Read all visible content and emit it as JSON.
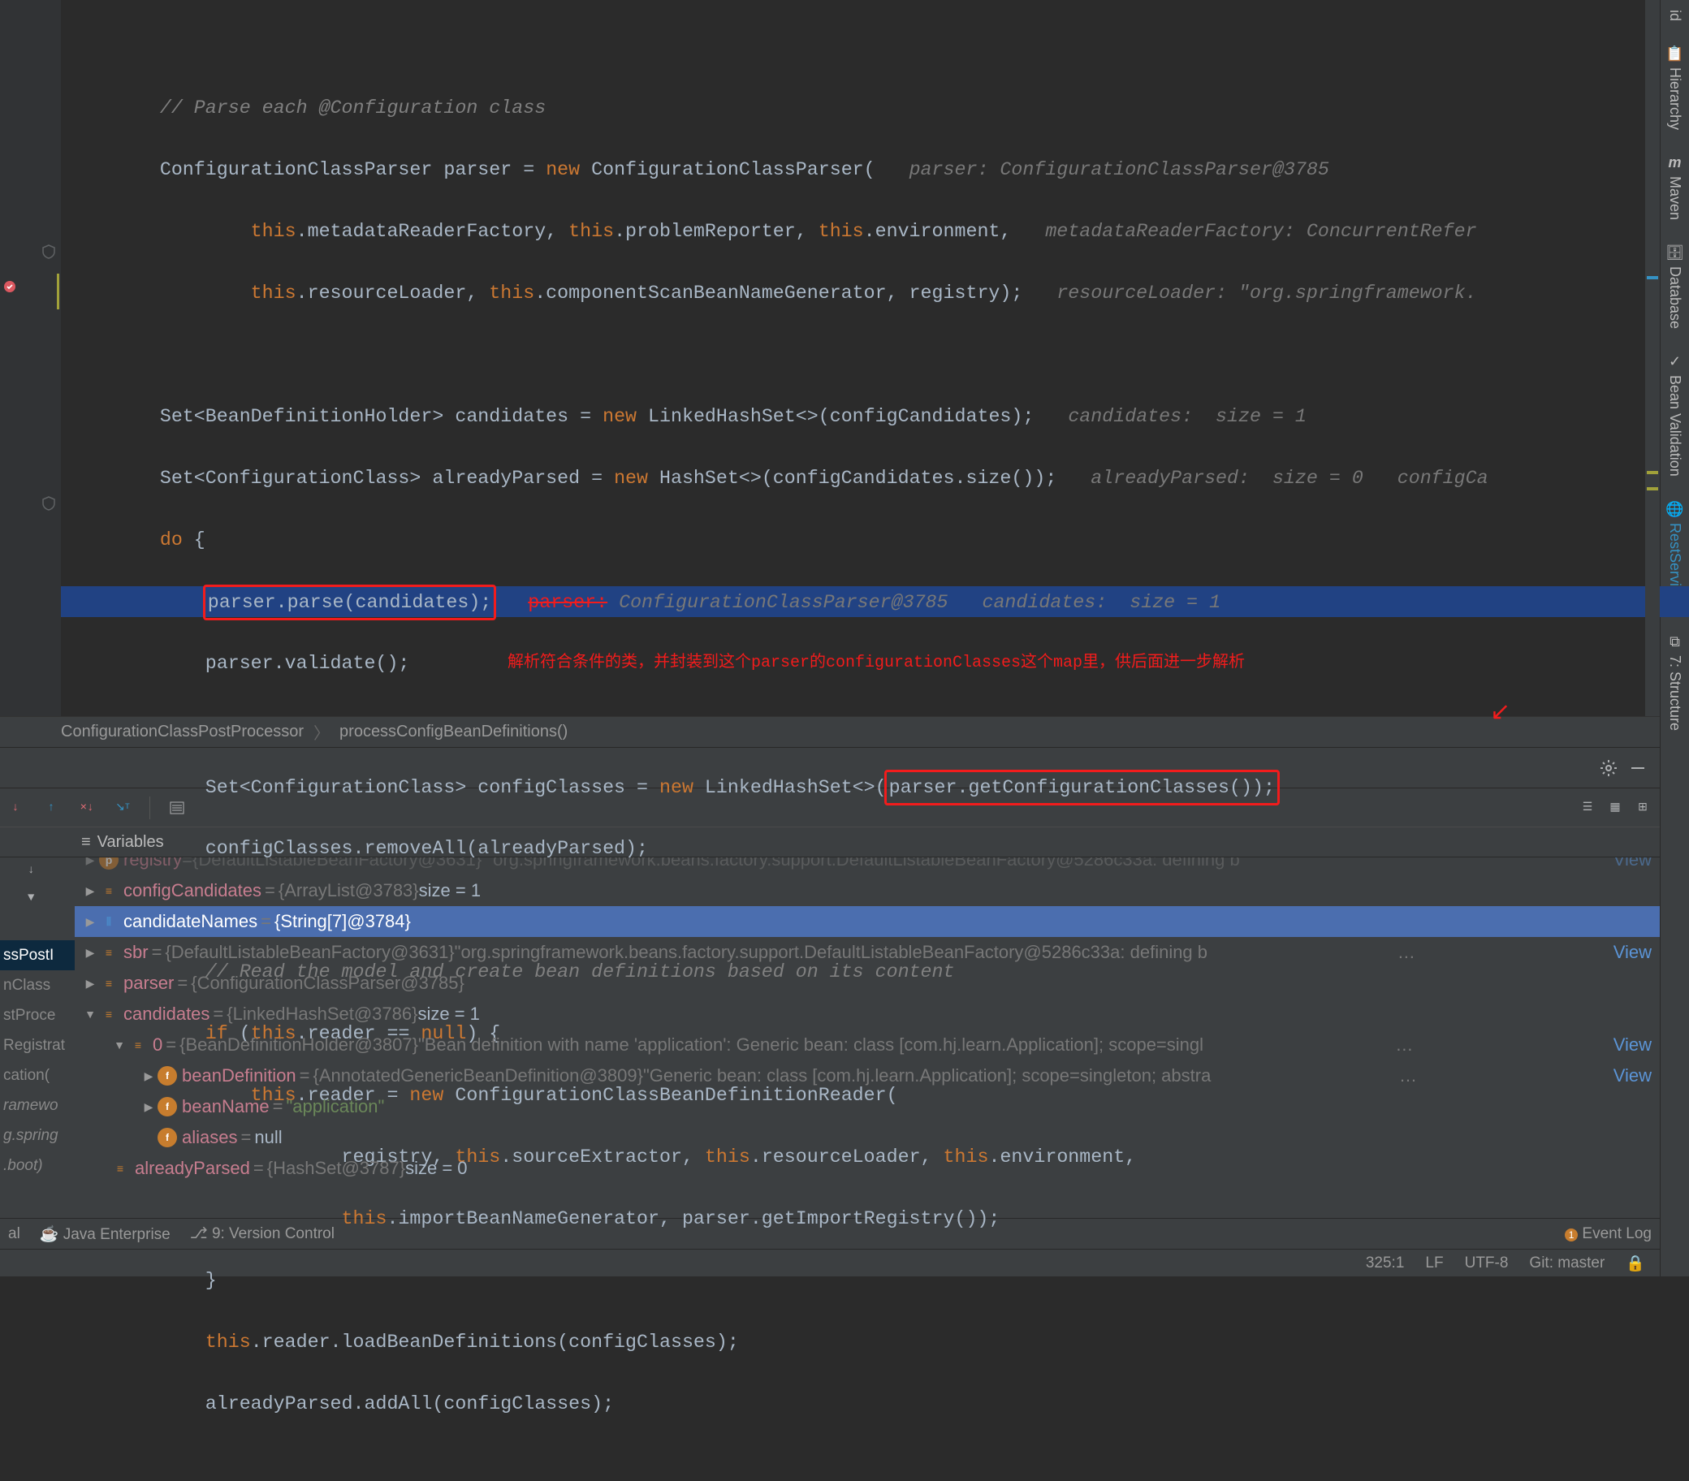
{
  "code": {
    "l1": "        // Parse each @Configuration class",
    "l2a": "        ConfigurationClassParser parser = ",
    "l2b": "new",
    "l2c": " ConfigurationClassParser(   ",
    "l2p": "parser: ConfigurationClassParser@3785",
    "l3a": "                this",
    "l3b": ".metadataReaderFactory, ",
    "l3c": "this",
    "l3d": ".problemReporter, ",
    "l3e": "this",
    "l3f": ".environment,   ",
    "l3p": "metadataReaderFactory: ConcurrentRefer",
    "l4a": "                this",
    "l4b": ".resourceLoader, ",
    "l4c": "this",
    "l4d": ".componentScanBeanNameGenerator, registry);   ",
    "l4p": "resourceLoader: \"org.springframework.",
    "l6a": "        Set<BeanDefinitionHolder> candidates = ",
    "l6b": "new",
    "l6c": " LinkedHashSet<>(configCandidates);   ",
    "l6p": "candidates:  size = 1",
    "l7a": "        Set<ConfigurationClass> alreadyParsed = ",
    "l7b": "new",
    "l7c": " HashSet<>(configCandidates.size());   ",
    "l7p": "alreadyParsed:  size = 0   configCa",
    "l8a": "        do",
    "l8b": " {",
    "l9a": "            ",
    "l9boxed": "parser.parse(candidates);",
    "l9b": "   ",
    "l9strike": "parser:",
    "l9p": " ConfigurationClassParser@3785   candidates:  size = 1",
    "l10": "            parser.validate();",
    "l10ann": "解析符合条件的类，并封装到这个parser的configurationClasses这个map里，供后面进一步解析",
    "l12a": "            Set<ConfigurationClass> configClasses = ",
    "l12b": "new",
    "l12c": " LinkedHashSet<>(",
    "l12boxed": "parser.getConfigurationClasses());",
    "l13": "            configClasses.removeAll(alreadyParsed);",
    "l15": "            // Read the model and create bean definitions based on its content",
    "l16a": "            if",
    "l16b": " (",
    "l16c": "this",
    "l16d": ".reader == ",
    "l16e": "null",
    "l16f": ") {",
    "l17a": "                this",
    "l17b": ".reader = ",
    "l17c": "new",
    "l17d": " ConfigurationClassBeanDefinitionReader(",
    "l18a": "                        registry, ",
    "l18b": "this",
    "l18c": ".sourceExtractor, ",
    "l18d": "this",
    "l18e": ".resourceLoader, ",
    "l18f": "this",
    "l18g": ".environment,",
    "l19a": "                        this",
    "l19b": ".importBeanNameGenerator, parser.getImportRegistry());",
    "l20": "            }",
    "l21a": "            this",
    "l21b": ".reader.loadBeanDefinitions(configClasses);",
    "l22": "            alreadyParsed.addAll(configClasses);"
  },
  "breadcrumb": {
    "a": "ConfigurationClassPostProcessor",
    "b": "processConfigBeanDefinitions()"
  },
  "varsHeader": "Variables",
  "vars": {
    "r0_name": "registry",
    "r0_val": "{DefaultListableBeanFactory@3631}  \"org.springframework.beans.factory.support.DefaultListableBeanFactory@5286c33a: defining b",
    "r1_name": "configCandidates",
    "r1_type": "{ArrayList@3783}",
    "r1_size": "  size = 1",
    "r2_name": "candidateNames",
    "r2_type": "{String[7]@3784}",
    "r3_name": "sbr",
    "r3_type": "{DefaultListableBeanFactory@3631}",
    "r3_val": " \"org.springframework.beans.factory.support.DefaultListableBeanFactory@5286c33a: defining b",
    "r4_name": "parser",
    "r4_type": "{ConfigurationClassParser@3785}",
    "r5_name": "candidates",
    "r5_type": "{LinkedHashSet@3786}",
    "r5_size": "  size = 1",
    "r6_name": "0",
    "r6_type": "{BeanDefinitionHolder@3807}",
    "r6_val": " \"Bean definition with name 'application': Generic bean: class [com.hj.learn.Application]; scope=singl",
    "r7_name": "beanDefinition",
    "r7_type": "{AnnotatedGenericBeanDefinition@3809}",
    "r7_val": " \"Generic bean: class [com.hj.learn.Application]; scope=singleton; abstra",
    "r8_name": "beanName",
    "r8_val": "\"application\"",
    "r9_name": "aliases",
    "r9_val": "null",
    "r10_name": "alreadyParsed",
    "r10_type": "{HashSet@3787}",
    "r10_size": "  size = 0",
    "view": "View"
  },
  "frames": {
    "f0": "ssPostI",
    "f1": "nClass",
    "f2": "stProce",
    "f3": "Registrat",
    "f4": "cation(",
    "f5": "ramewo",
    "f6": "g.spring",
    "f7": ".boot)"
  },
  "status": {
    "left1": "al",
    "je": "Java Enterprise",
    "vc": "9: Version Control",
    "evlog": "Event Log",
    "pos": "325:1",
    "lf": "LF",
    "enc": "UTF-8",
    "git": "Git: master"
  },
  "rightTabs": {
    "t0": "id",
    "t1": "Hierarchy",
    "t2": "Maven",
    "t3": "Database",
    "t4": "Bean Validation",
    "t5": "RestServices",
    "t6": "7: Structure"
  }
}
